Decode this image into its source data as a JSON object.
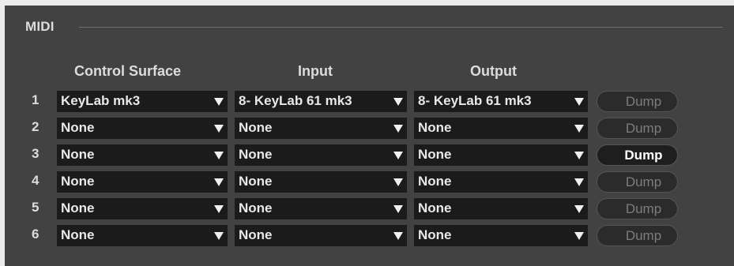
{
  "section": {
    "title": "MIDI"
  },
  "headers": {
    "control_surface": "Control Surface",
    "input": "Input",
    "output": "Output"
  },
  "rows": [
    {
      "num": "1",
      "control_surface": "KeyLab mk3",
      "input": "8- KeyLab 61 mk3",
      "output": "8- KeyLab 61 mk3",
      "dump": "Dump",
      "dump_enabled": false
    },
    {
      "num": "2",
      "control_surface": "None",
      "input": "None",
      "output": "None",
      "dump": "Dump",
      "dump_enabled": false
    },
    {
      "num": "3",
      "control_surface": "None",
      "input": "None",
      "output": "None",
      "dump": "Dump",
      "dump_enabled": true
    },
    {
      "num": "4",
      "control_surface": "None",
      "input": "None",
      "output": "None",
      "dump": "Dump",
      "dump_enabled": false
    },
    {
      "num": "5",
      "control_surface": "None",
      "input": "None",
      "output": "None",
      "dump": "Dump",
      "dump_enabled": false
    },
    {
      "num": "6",
      "control_surface": "None",
      "input": "None",
      "output": "None",
      "dump": "Dump",
      "dump_enabled": false
    }
  ],
  "colors": {
    "panel_bg": "#424242",
    "select_bg": "#1b1b1b",
    "text": "#dcdcdc",
    "dump_disabled_text": "#7d7d7d",
    "dump_enabled_text": "#ffffff"
  }
}
